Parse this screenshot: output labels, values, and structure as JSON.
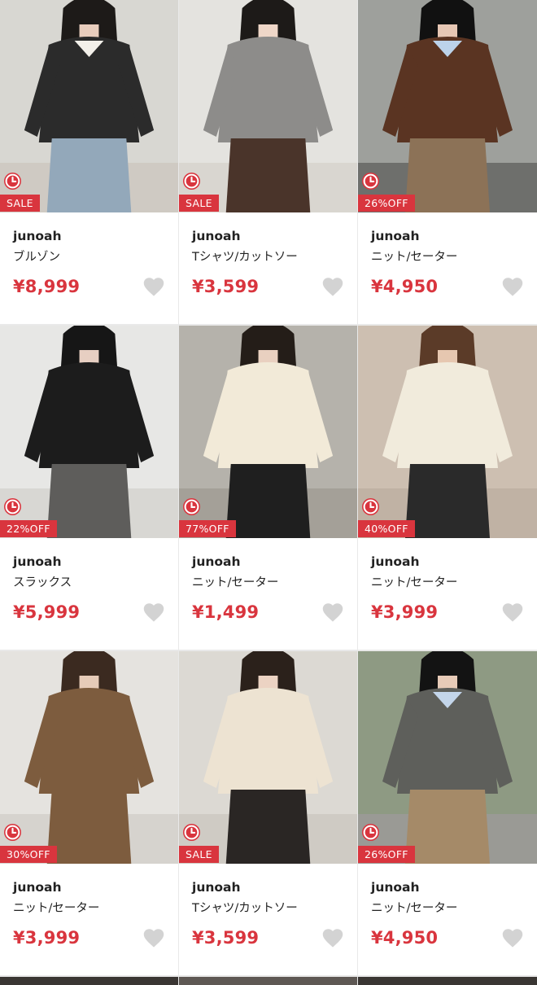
{
  "colors": {
    "accent": "#d9353e",
    "heart": "#d3d3d3"
  },
  "products": [
    {
      "brand": "junoah",
      "category": "ブルゾン",
      "price": "¥8,999",
      "badge": "SALE",
      "photo": {
        "bg": "#d8d7d2",
        "floor": "#cfcac3",
        "top": "#2b2b2b",
        "bottom": "#93a8ba",
        "hair": "#1d1a18",
        "skin": "#e8cdbd",
        "inner": "#f3f0ea"
      }
    },
    {
      "brand": "junoah",
      "category": "Tシャツ/カットソー",
      "price": "¥3,599",
      "badge": "SALE",
      "photo": {
        "bg": "#e4e3df",
        "floor": "#d9d6d0",
        "top": "#8d8c8a",
        "bottom": "#4a342a",
        "hair": "#1d1a18",
        "skin": "#efd7c8",
        "inner": "#8d8c8a"
      }
    },
    {
      "brand": "junoah",
      "category": "ニット/セーター",
      "price": "¥4,950",
      "badge": "26%OFF",
      "photo": {
        "bg": "#9ea09c",
        "floor": "#6e6f6c",
        "top": "#5a3422",
        "bottom": "#8c7257",
        "hair": "#111111",
        "skin": "#e6c7b4",
        "inner": "#bcd2ea"
      }
    },
    {
      "brand": "junoah",
      "category": "スラックス",
      "price": "¥5,999",
      "badge": "22%OFF",
      "photo": {
        "bg": "#e7e7e5",
        "floor": "#d8d7d3",
        "top": "#1c1c1c",
        "bottom": "#5e5d5b",
        "hair": "#161616",
        "skin": "#e7cfc2",
        "inner": "#1c1c1c"
      }
    },
    {
      "brand": "junoah",
      "category": "ニット/セーター",
      "price": "¥1,499",
      "badge": "77%OFF",
      "photo": {
        "bg": "#b5b2ab",
        "floor": "#a4a098",
        "top": "#f2ead8",
        "bottom": "#1f1f1f",
        "hair": "#241d18",
        "skin": "#e9d0c0",
        "inner": "#f2ead8"
      }
    },
    {
      "brand": "junoah",
      "category": "ニット/セーター",
      "price": "¥3,999",
      "badge": "40%OFF",
      "photo": {
        "bg": "#cdbfb1",
        "floor": "#c0b2a4",
        "top": "#f1ebdc",
        "bottom": "#2a2a2a",
        "hair": "#5b3b28",
        "skin": "#e6c7b0",
        "inner": "#f1ebdc"
      }
    },
    {
      "brand": "junoah",
      "category": "ニット/セーター",
      "price": "¥3,999",
      "badge": "30%OFF",
      "photo": {
        "bg": "#e5e3df",
        "floor": "#d6d3ce",
        "top": "#7d5c3e",
        "bottom": "#7d5c3e",
        "hair": "#3b2a20",
        "skin": "#e6cbb8",
        "inner": "#7d5c3e"
      }
    },
    {
      "brand": "junoah",
      "category": "Tシャツ/カットソー",
      "price": "¥3,599",
      "badge": "SALE",
      "photo": {
        "bg": "#dcd9d3",
        "floor": "#cfcbc4",
        "top": "#ede3d2",
        "bottom": "#2a2624",
        "hair": "#2b211b",
        "skin": "#ecd3c3",
        "inner": "#ede3d2"
      }
    },
    {
      "brand": "junoah",
      "category": "ニット/セーター",
      "price": "¥4,950",
      "badge": "26%OFF",
      "photo": {
        "bg": "#8e9a83",
        "floor": "#9a9a95",
        "top": "#5e5f5b",
        "bottom": "#a58a68",
        "hair": "#131313",
        "skin": "#e7cbb8",
        "inner": "#c3d5ea"
      }
    }
  ]
}
